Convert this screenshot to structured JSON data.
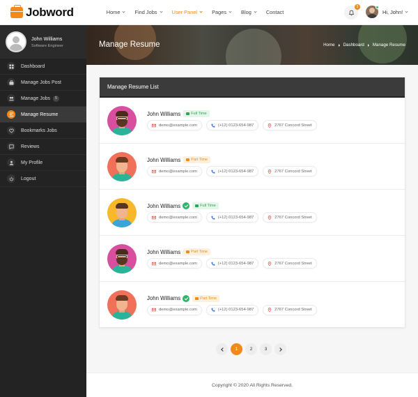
{
  "brand": {
    "name": "Jobword"
  },
  "nav": [
    {
      "label": "Home",
      "dropdown": true,
      "active": false
    },
    {
      "label": "Find Jobs",
      "dropdown": true,
      "active": false
    },
    {
      "label": "User Panel",
      "dropdown": true,
      "active": true
    },
    {
      "label": "Pages",
      "dropdown": true,
      "active": false
    },
    {
      "label": "Blog",
      "dropdown": true,
      "active": false
    },
    {
      "label": "Contact",
      "dropdown": false,
      "active": false
    }
  ],
  "notifications": {
    "count": "5"
  },
  "user_menu": {
    "greeting": "Hi, John!"
  },
  "sidebar": {
    "profile": {
      "name": "John Williams",
      "role": "Software Engineer"
    },
    "items": [
      {
        "label": "Dashboard",
        "icon": "dashboard-icon",
        "active": false
      },
      {
        "label": "Manage Jobs Post",
        "icon": "briefcase-icon",
        "active": false
      },
      {
        "label": "Manage Jobs",
        "icon": "users-icon",
        "active": false,
        "count": "5"
      },
      {
        "label": "Manage Resume",
        "icon": "resume-icon",
        "active": true
      },
      {
        "label": "Bookmarks Jobs",
        "icon": "heart-icon",
        "active": false
      },
      {
        "label": "Reviews",
        "icon": "chat-icon",
        "active": false
      },
      {
        "label": "My Profile",
        "icon": "user-icon",
        "active": false
      },
      {
        "label": "Logout",
        "icon": "power-icon",
        "active": false
      }
    ]
  },
  "banner": {
    "title": "Manage Resume",
    "breadcrumb": [
      "Home",
      "Dashboard",
      "Manage Resume"
    ]
  },
  "resume_list": {
    "title": "Manage Resume List",
    "rows": [
      {
        "name": "John Williams",
        "verified": false,
        "type": "Full Time",
        "email": "demo@example.com",
        "phone": "(+12) 0123-654-987",
        "address": "2767 Concord Street",
        "avatar_bg": "#d94fa0",
        "shirt": "#2bb39a",
        "hair": "#4a2c1a",
        "beard": true,
        "glasses": true
      },
      {
        "name": "John Williams",
        "verified": false,
        "type": "Part Time",
        "email": "demo@example.com",
        "phone": "(+12) 0123-654-987",
        "address": "2767 Concord Street",
        "avatar_bg": "#f0705a",
        "shirt": "#2bb39a",
        "hair": "#6b3a22",
        "beard": false,
        "glasses": false
      },
      {
        "name": "John Williams",
        "verified": true,
        "type": "Full Time",
        "email": "demo@example.com",
        "phone": "(+12) 0123-654-987",
        "address": "2767 Concord Street",
        "avatar_bg": "#f7b92b",
        "shirt": "#3aa5d6",
        "hair": "#5a3521",
        "beard": false,
        "glasses": false
      },
      {
        "name": "John Williams",
        "verified": false,
        "type": "Part Time",
        "email": "demo@example.com",
        "phone": "(+12) 0123-654-987",
        "address": "2767 Concord Street",
        "avatar_bg": "#d94fa0",
        "shirt": "#2bb39a",
        "hair": "#4a2c1a",
        "beard": true,
        "glasses": true
      },
      {
        "name": "John Williams",
        "verified": true,
        "type": "Part Time",
        "email": "demo@example.com",
        "phone": "(+12) 0123-654-987",
        "address": "2767 Concord Street",
        "avatar_bg": "#f0705a",
        "shirt": "#2bb39a",
        "hair": "#6b3a22",
        "beard": false,
        "glasses": false
      }
    ]
  },
  "pagination": {
    "pages": [
      "1",
      "2",
      "3"
    ],
    "current": "1"
  },
  "footer": {
    "copyright": "Copyright © 2020 All Rights Reserved."
  },
  "colors": {
    "accent": "#f18a1c",
    "sidebar": "#232323",
    "success": "#2fb56a"
  }
}
